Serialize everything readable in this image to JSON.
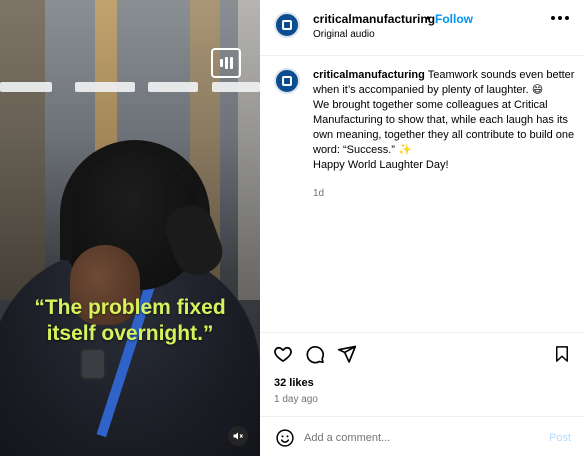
{
  "video": {
    "caption_line1": "“The problem fixed",
    "caption_line2": "itself overnight.”",
    "caption_color": "#d7f35c",
    "badge_icon": "reels-icon",
    "mute_icon": "muted-speaker-icon"
  },
  "header": {
    "username": "criticalmanufacturing",
    "separator": "•",
    "follow_label": "Follow",
    "audio_label": "Original audio",
    "more_icon": "more-options-icon"
  },
  "caption_post": {
    "username": "criticalmanufacturing",
    "line1": "Teamwork sounds even better when it’s accompanied by plenty of laughter. 😄",
    "line2": "We brought together some colleagues at Critical Manufacturing to show that, while each laugh has its own meaning, together they all contribute to build one word: “Success.” ✨",
    "line3": "Happy World Laughter Day!",
    "time": "1d"
  },
  "actions": {
    "like_icon": "heart-icon",
    "comment_icon": "comment-icon",
    "share_icon": "share-icon",
    "save_icon": "bookmark-icon"
  },
  "stats": {
    "likes": "32 likes",
    "posted": "1 day ago"
  },
  "add_comment": {
    "emoji_icon": "emoji-icon",
    "placeholder": "Add a comment...",
    "post_label": "Post"
  },
  "colors": {
    "accent": "#0095f6",
    "post_disabled": "#b3dbff",
    "brand": "#0b4d8f"
  }
}
